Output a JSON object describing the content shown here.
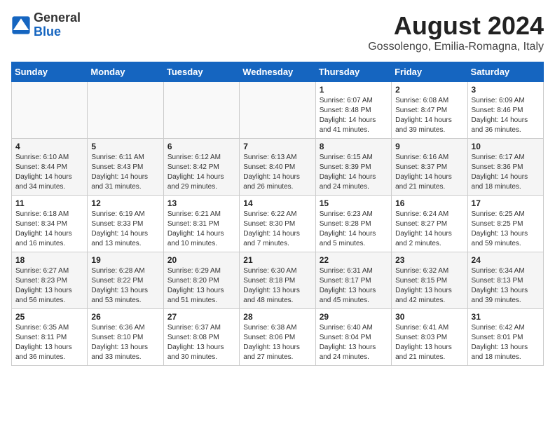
{
  "logo": {
    "general": "General",
    "blue": "Blue"
  },
  "title": "August 2024",
  "subtitle": "Gossolengo, Emilia-Romagna, Italy",
  "days_of_week": [
    "Sunday",
    "Monday",
    "Tuesday",
    "Wednesday",
    "Thursday",
    "Friday",
    "Saturday"
  ],
  "weeks": [
    [
      {
        "day": "",
        "info": ""
      },
      {
        "day": "",
        "info": ""
      },
      {
        "day": "",
        "info": ""
      },
      {
        "day": "",
        "info": ""
      },
      {
        "day": "1",
        "info": "Sunrise: 6:07 AM\nSunset: 8:48 PM\nDaylight: 14 hours and 41 minutes."
      },
      {
        "day": "2",
        "info": "Sunrise: 6:08 AM\nSunset: 8:47 PM\nDaylight: 14 hours and 39 minutes."
      },
      {
        "day": "3",
        "info": "Sunrise: 6:09 AM\nSunset: 8:46 PM\nDaylight: 14 hours and 36 minutes."
      }
    ],
    [
      {
        "day": "4",
        "info": "Sunrise: 6:10 AM\nSunset: 8:44 PM\nDaylight: 14 hours and 34 minutes."
      },
      {
        "day": "5",
        "info": "Sunrise: 6:11 AM\nSunset: 8:43 PM\nDaylight: 14 hours and 31 minutes."
      },
      {
        "day": "6",
        "info": "Sunrise: 6:12 AM\nSunset: 8:42 PM\nDaylight: 14 hours and 29 minutes."
      },
      {
        "day": "7",
        "info": "Sunrise: 6:13 AM\nSunset: 8:40 PM\nDaylight: 14 hours and 26 minutes."
      },
      {
        "day": "8",
        "info": "Sunrise: 6:15 AM\nSunset: 8:39 PM\nDaylight: 14 hours and 24 minutes."
      },
      {
        "day": "9",
        "info": "Sunrise: 6:16 AM\nSunset: 8:37 PM\nDaylight: 14 hours and 21 minutes."
      },
      {
        "day": "10",
        "info": "Sunrise: 6:17 AM\nSunset: 8:36 PM\nDaylight: 14 hours and 18 minutes."
      }
    ],
    [
      {
        "day": "11",
        "info": "Sunrise: 6:18 AM\nSunset: 8:34 PM\nDaylight: 14 hours and 16 minutes."
      },
      {
        "day": "12",
        "info": "Sunrise: 6:19 AM\nSunset: 8:33 PM\nDaylight: 14 hours and 13 minutes."
      },
      {
        "day": "13",
        "info": "Sunrise: 6:21 AM\nSunset: 8:31 PM\nDaylight: 14 hours and 10 minutes."
      },
      {
        "day": "14",
        "info": "Sunrise: 6:22 AM\nSunset: 8:30 PM\nDaylight: 14 hours and 7 minutes."
      },
      {
        "day": "15",
        "info": "Sunrise: 6:23 AM\nSunset: 8:28 PM\nDaylight: 14 hours and 5 minutes."
      },
      {
        "day": "16",
        "info": "Sunrise: 6:24 AM\nSunset: 8:27 PM\nDaylight: 14 hours and 2 minutes."
      },
      {
        "day": "17",
        "info": "Sunrise: 6:25 AM\nSunset: 8:25 PM\nDaylight: 13 hours and 59 minutes."
      }
    ],
    [
      {
        "day": "18",
        "info": "Sunrise: 6:27 AM\nSunset: 8:23 PM\nDaylight: 13 hours and 56 minutes."
      },
      {
        "day": "19",
        "info": "Sunrise: 6:28 AM\nSunset: 8:22 PM\nDaylight: 13 hours and 53 minutes."
      },
      {
        "day": "20",
        "info": "Sunrise: 6:29 AM\nSunset: 8:20 PM\nDaylight: 13 hours and 51 minutes."
      },
      {
        "day": "21",
        "info": "Sunrise: 6:30 AM\nSunset: 8:18 PM\nDaylight: 13 hours and 48 minutes."
      },
      {
        "day": "22",
        "info": "Sunrise: 6:31 AM\nSunset: 8:17 PM\nDaylight: 13 hours and 45 minutes."
      },
      {
        "day": "23",
        "info": "Sunrise: 6:32 AM\nSunset: 8:15 PM\nDaylight: 13 hours and 42 minutes."
      },
      {
        "day": "24",
        "info": "Sunrise: 6:34 AM\nSunset: 8:13 PM\nDaylight: 13 hours and 39 minutes."
      }
    ],
    [
      {
        "day": "25",
        "info": "Sunrise: 6:35 AM\nSunset: 8:11 PM\nDaylight: 13 hours and 36 minutes."
      },
      {
        "day": "26",
        "info": "Sunrise: 6:36 AM\nSunset: 8:10 PM\nDaylight: 13 hours and 33 minutes."
      },
      {
        "day": "27",
        "info": "Sunrise: 6:37 AM\nSunset: 8:08 PM\nDaylight: 13 hours and 30 minutes."
      },
      {
        "day": "28",
        "info": "Sunrise: 6:38 AM\nSunset: 8:06 PM\nDaylight: 13 hours and 27 minutes."
      },
      {
        "day": "29",
        "info": "Sunrise: 6:40 AM\nSunset: 8:04 PM\nDaylight: 13 hours and 24 minutes."
      },
      {
        "day": "30",
        "info": "Sunrise: 6:41 AM\nSunset: 8:03 PM\nDaylight: 13 hours and 21 minutes."
      },
      {
        "day": "31",
        "info": "Sunrise: 6:42 AM\nSunset: 8:01 PM\nDaylight: 13 hours and 18 minutes."
      }
    ]
  ]
}
